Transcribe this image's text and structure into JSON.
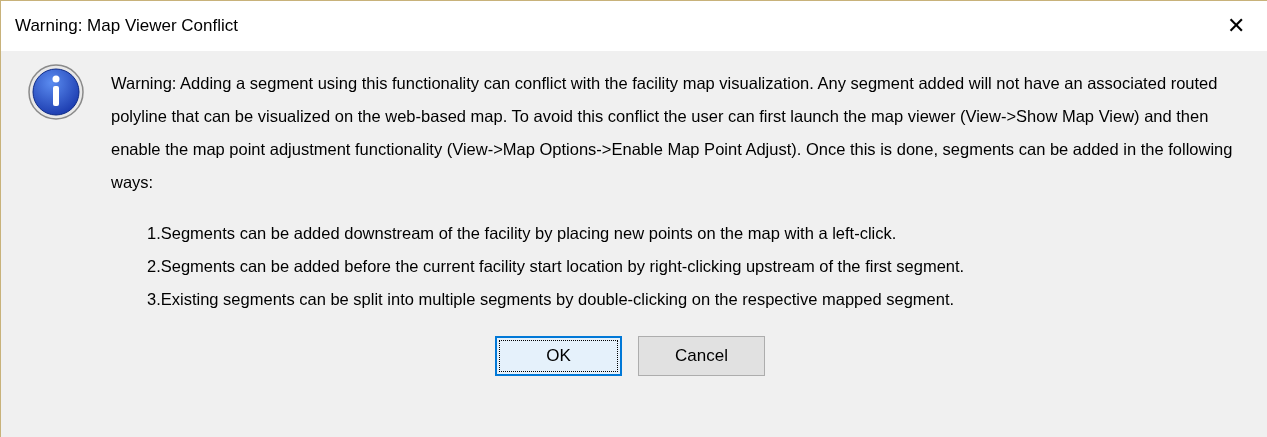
{
  "window": {
    "title": "Warning: Map Viewer Conflict",
    "close": "✕"
  },
  "message": "Warning: Adding a segment using this functionality can conflict with the facility map visualization. Any segment added will not have an associated routed polyline that can be visualized on the web-based map. To avoid this conflict the user can first launch the map viewer (View->Show Map View) and then enable the map point adjustment functionality (View->Map Options->Enable Map Point Adjust). Once this is done, segments can be added in the following ways:",
  "steps": [
    "1.Segments can be added downstream of the facility by placing new points on the map with a left-click.",
    "2.Segments can be added before the current facility start location by right-clicking upstream of the first segment.",
    "3.Existing segments can be split into multiple segments by double-clicking on the respective mapped segment."
  ],
  "buttons": [
    {
      "label": "OK",
      "focused": true
    },
    {
      "label": "Cancel",
      "focused": false
    }
  ]
}
